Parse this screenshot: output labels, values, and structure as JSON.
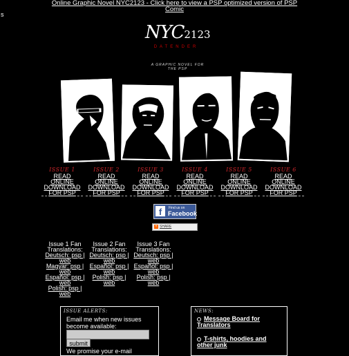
{
  "top_banner": {
    "line1": "Online Graphic Novel NYC2123 - Click here to view a PSP optimized version of PSP",
    "line2": "Comic"
  },
  "stray_char": "s",
  "logo": {
    "title": "NYC",
    "number": "2123",
    "subtitle": "DATENDER"
  },
  "tagline": "A GRAPHIC NOVEL FOR THE PSP",
  "issues": [
    {
      "title": "ISSUE 1",
      "read": "READ ONLINE",
      "download": "DOWNLOAD FOR PSP"
    },
    {
      "title": "ISSUE 2",
      "read": "READ ONLINE",
      "download": "DOWNLOAD FOR PSP"
    },
    {
      "title": "ISSUE 3",
      "read": "READ ONLINE",
      "download": "DOWNLOAD FOR PSP"
    },
    {
      "title": "ISSUE 4",
      "read": "READ ONLINE",
      "download": "DOWNLOAD FOR PSP"
    },
    {
      "title": "ISSUE 5",
      "read": "READ ONLINE",
      "download": "DOWNLOAD FOR PSP"
    },
    {
      "title": "ISSUE 6",
      "read": "READ ONLINE",
      "download": "DOWNLOAD FOR PSP"
    }
  ],
  "facebook": {
    "small": "Find us on",
    "big": "Facebook"
  },
  "share_label": "SHARE",
  "fan_translations": [
    {
      "head": "Issue 1 Fan Translations:",
      "rows": [
        "Deutsch: psp |",
        "web",
        "Magyar: psp |",
        "web",
        "Español: psp |",
        "web",
        "Polish: psp |",
        "web"
      ]
    },
    {
      "head": "Issue 2 Fan Translations:",
      "rows": [
        "Deutsch: psp |",
        "web",
        "Español: psp |",
        "web",
        "Polish: psp |",
        "web"
      ]
    },
    {
      "head": "Issue 3 Fan Translations:",
      "rows": [
        "Deutsch: psp |",
        "web",
        "Español: psp |",
        "web",
        "Polish: psp |",
        "web"
      ]
    }
  ],
  "alerts": {
    "heading": "ISSUE ALERTS:",
    "text": "Email me when new issues become available:",
    "email_value": "",
    "submit": "submit",
    "promise": "We promise your e-mail"
  },
  "news": {
    "heading": "NEWS:",
    "items": [
      "Message Board for Translators",
      "T-shirts, hoodies and other junk"
    ]
  },
  "colors": {
    "background": "#000000",
    "accent": "#d0262b",
    "facebook": "#3b5998"
  }
}
